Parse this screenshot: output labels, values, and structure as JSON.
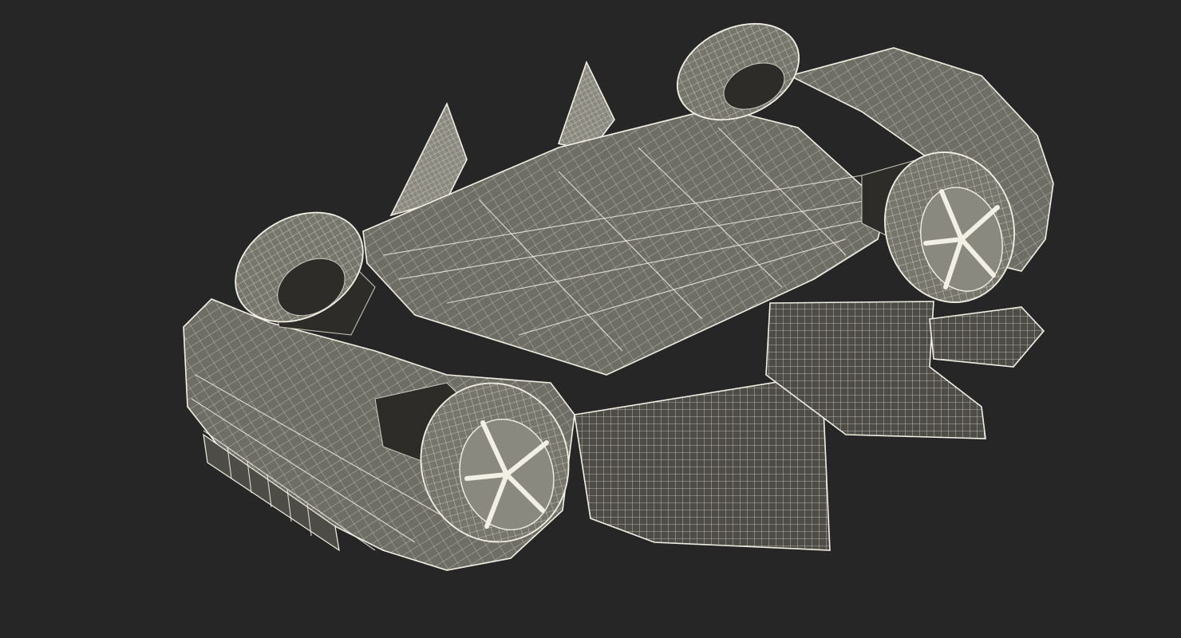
{
  "scene": {
    "subject": "wireframe-car-underside",
    "colors": {
      "background": "#262626",
      "surface": "#6f6e66",
      "surface_light": "#8a8980",
      "surface_dark": "#4d4c46",
      "wire": "#f2f0e4",
      "wire_dim": "#cfcdc0",
      "tire": "#77766d",
      "void": "#2d2c29"
    }
  }
}
